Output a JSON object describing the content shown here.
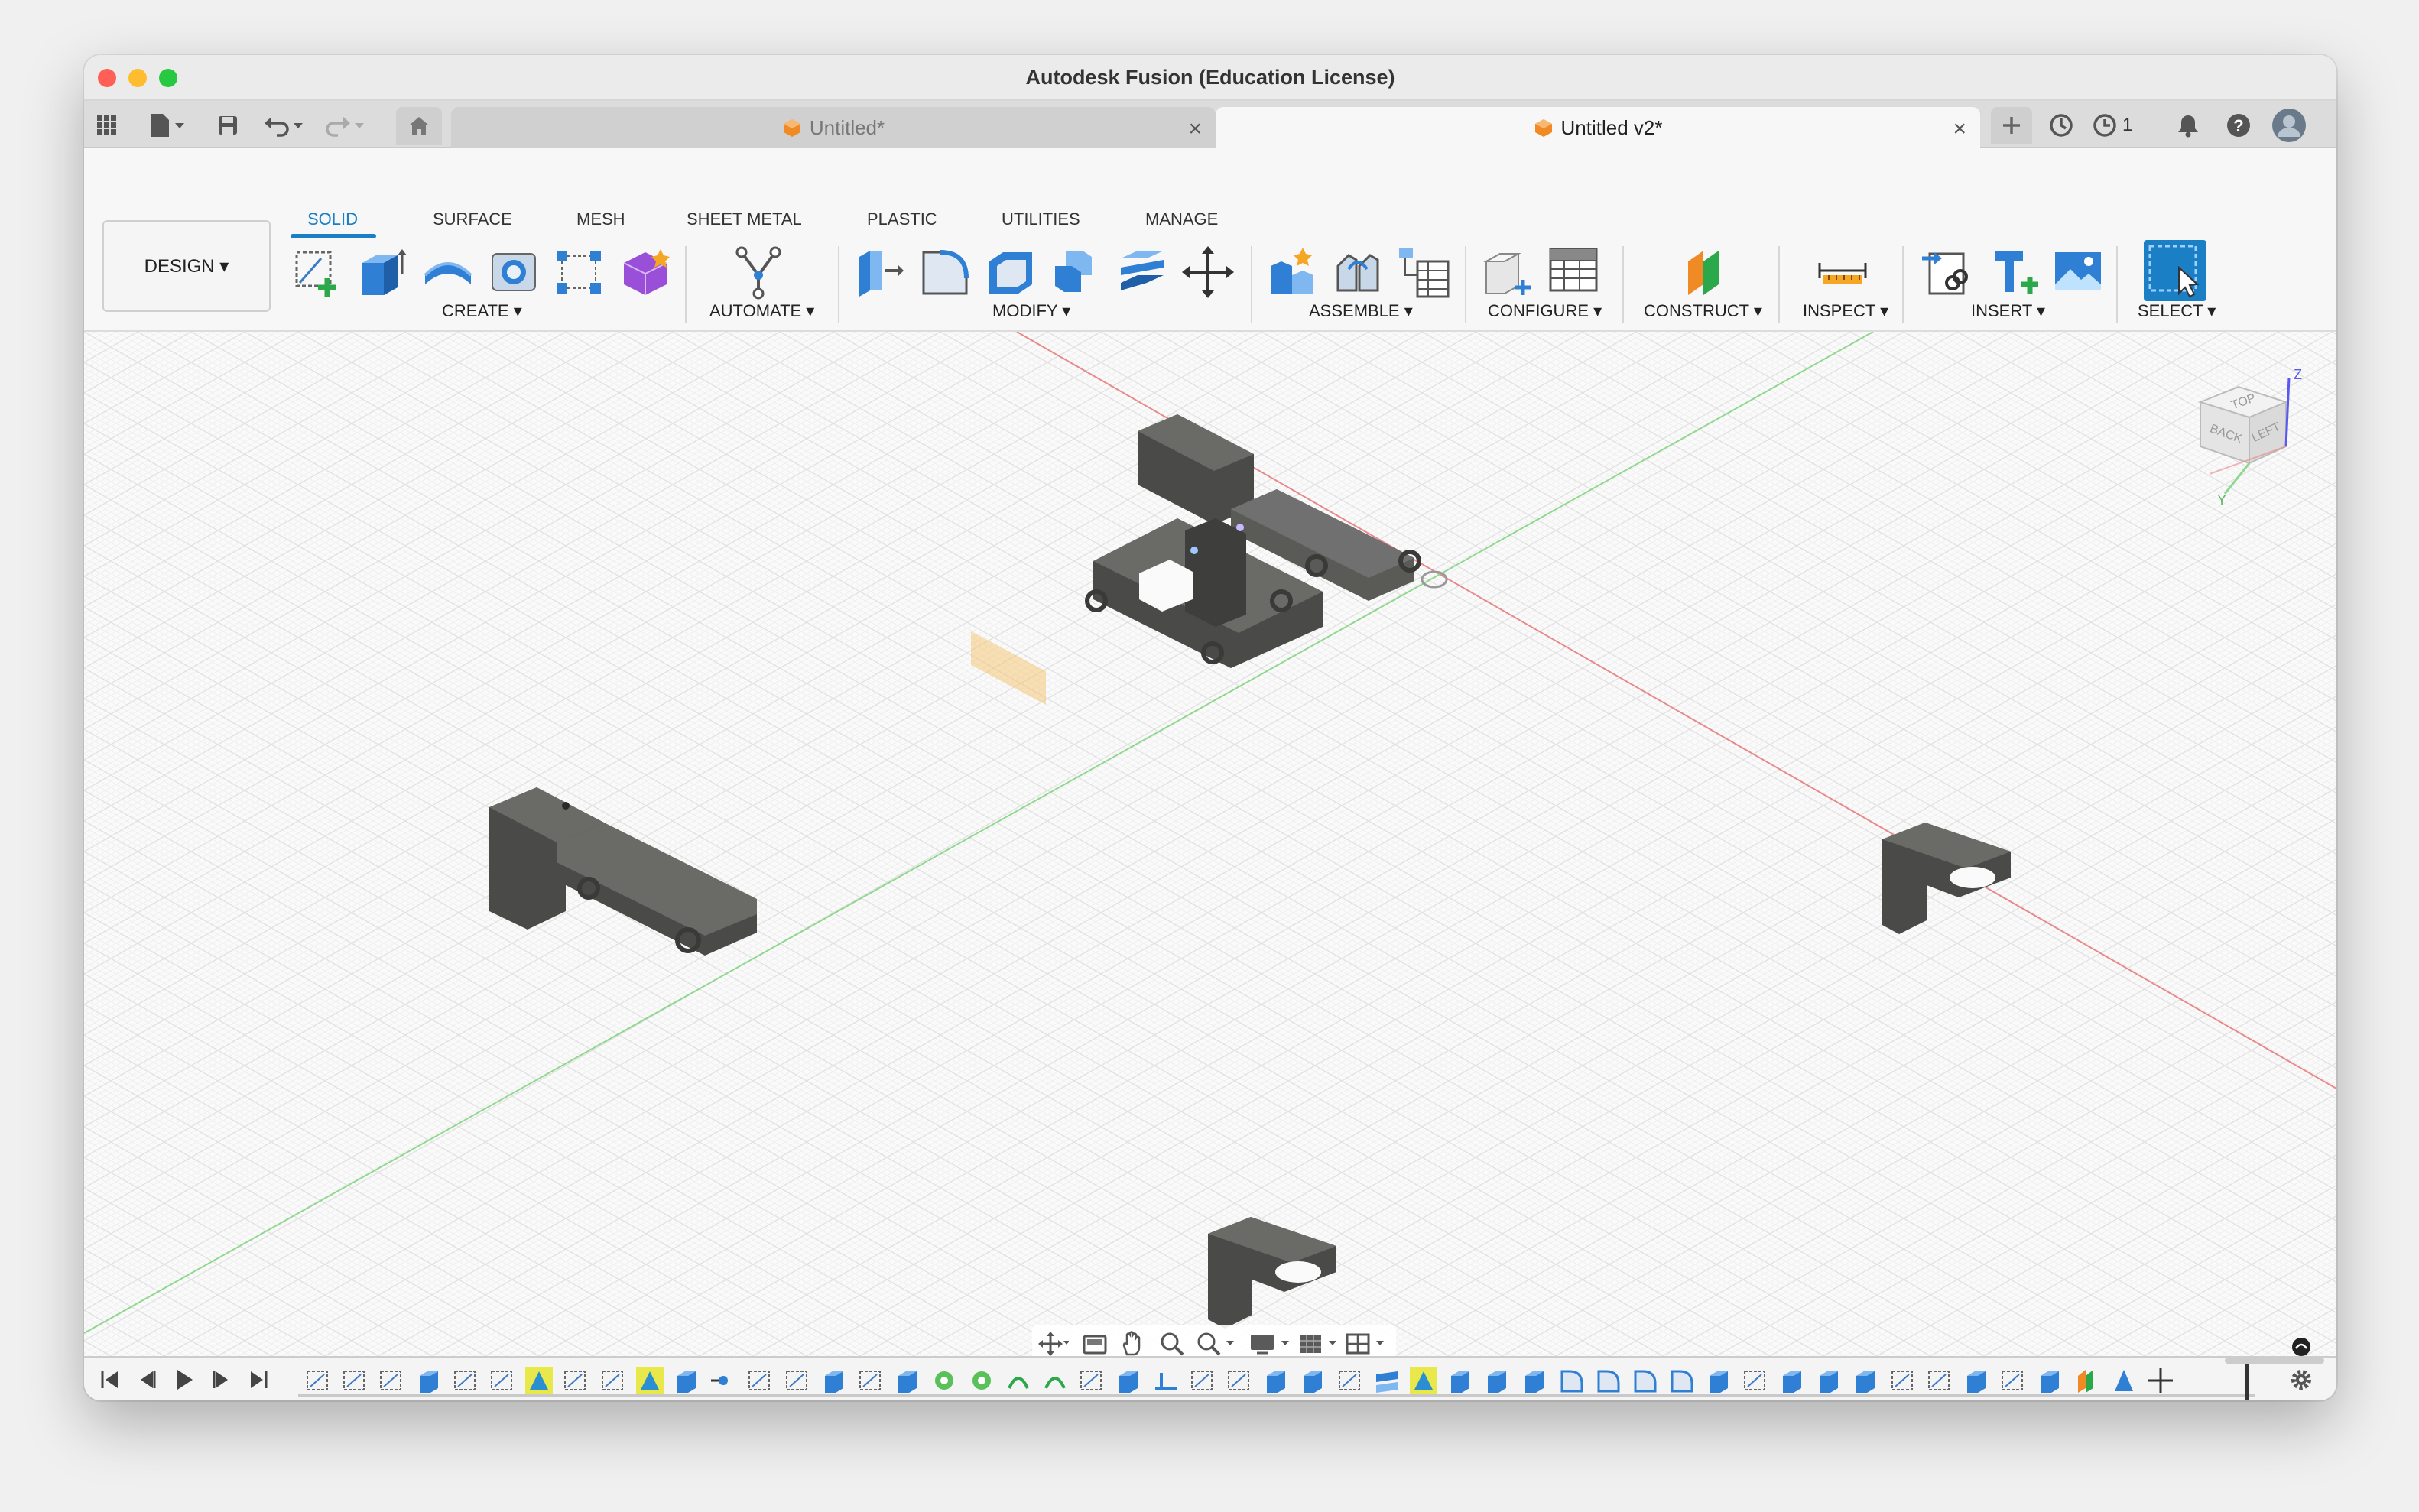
{
  "window": {
    "title": "Autodesk Fusion (Education License)",
    "traffic": {
      "close": "#ff5f57",
      "minimize": "#febc2e",
      "zoom": "#28c840"
    }
  },
  "tabs": [
    {
      "label": "Untitled*",
      "active": false
    },
    {
      "label": "Untitled v2*",
      "active": true
    }
  ],
  "tabbar_right": {
    "jobs_count": "1"
  },
  "toolbar": {
    "workspace_button": "DESIGN ▾",
    "workspace_tabs": [
      "SOLID",
      "SURFACE",
      "MESH",
      "SHEET METAL",
      "PLASTIC",
      "UTILITIES",
      "MANAGE"
    ],
    "active_workspace_tab": "SOLID",
    "groups": [
      {
        "label": "CREATE ▾"
      },
      {
        "label": "AUTOMATE ▾"
      },
      {
        "label": "MODIFY ▾"
      },
      {
        "label": "ASSEMBLE ▾"
      },
      {
        "label": "CONFIGURE ▾"
      },
      {
        "label": "CONSTRUCT ▾"
      },
      {
        "label": "INSPECT ▾"
      },
      {
        "label": "INSERT ▾"
      },
      {
        "label": "SELECT ▾"
      }
    ]
  },
  "viewcube": {
    "faces": [
      "TOP",
      "BACK",
      "LEFT"
    ],
    "axes": [
      "Z",
      "Y"
    ]
  },
  "colors": {
    "accent": "#1a7fc4",
    "x_axis": "#e88a8a",
    "y_axis": "#8fd88f",
    "z_axis": "#5a5af0",
    "part": "#4a4a48",
    "plane": "#f5c26b"
  },
  "timeline": {
    "controls": [
      "skip-to-start",
      "step-back",
      "play",
      "step-forward",
      "skip-to-end"
    ]
  }
}
